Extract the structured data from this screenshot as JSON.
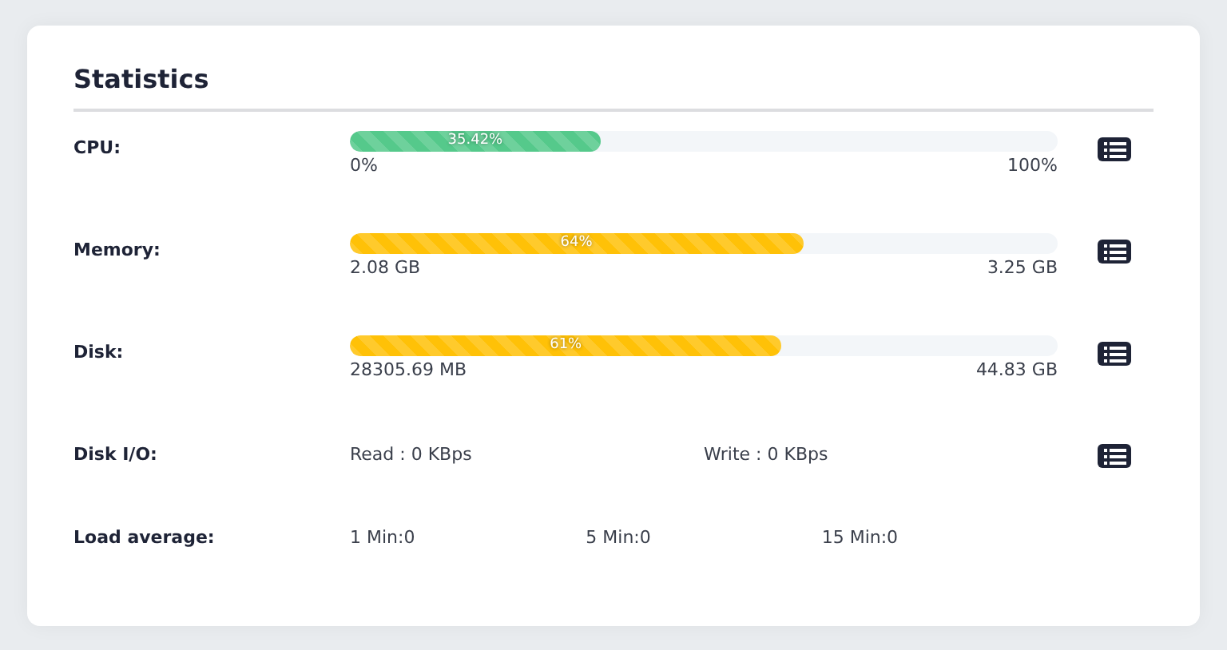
{
  "title": "Statistics",
  "rows": [
    {
      "kind": "bar",
      "label": "CPU:",
      "bar_text": "35.42%",
      "level": 0.3542,
      "color": "#55c98b",
      "min": "0%",
      "max": "100%",
      "has_icon": true
    },
    {
      "kind": "bar",
      "label": "Memory:",
      "bar_text": "64%",
      "level": 0.64,
      "color": "#ffc107",
      "min": "2.08 GB",
      "max": "3.25 GB",
      "has_icon": true
    },
    {
      "kind": "bar",
      "label": "Disk:",
      "bar_text": "61%",
      "level": 0.61,
      "color": "#ffc107",
      "min": "28305.69 MB",
      "max": "44.83 GB",
      "has_icon": true
    },
    {
      "kind": "io",
      "label": "Disk I/O:",
      "values": [
        "Read : 0 KBps",
        "Write : 0 KBps"
      ],
      "has_icon": true
    },
    {
      "kind": "load",
      "label": "Load average:",
      "values": [
        "1 Min:0",
        "5 Min:0",
        "15 Min:0"
      ],
      "has_icon": false
    }
  ]
}
